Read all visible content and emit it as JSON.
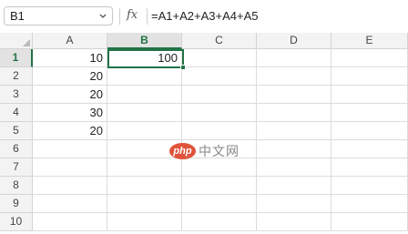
{
  "formula_bar": {
    "name_box": "B1",
    "fx_label": "fx",
    "formula": "=A1+A2+A3+A4+A5"
  },
  "columns": [
    "A",
    "B",
    "C",
    "D",
    "E"
  ],
  "rows": [
    "1",
    "2",
    "3",
    "4",
    "5",
    "6",
    "7",
    "8",
    "9",
    "10"
  ],
  "cells": {
    "A1": "10",
    "A2": "20",
    "A3": "20",
    "A4": "30",
    "A5": "20",
    "B1": "100"
  },
  "selection": {
    "cell": "B1",
    "column": "B",
    "row": "1",
    "accent_color": "#217346"
  },
  "watermark": {
    "logo_text": "php",
    "site_text": "中文网"
  }
}
